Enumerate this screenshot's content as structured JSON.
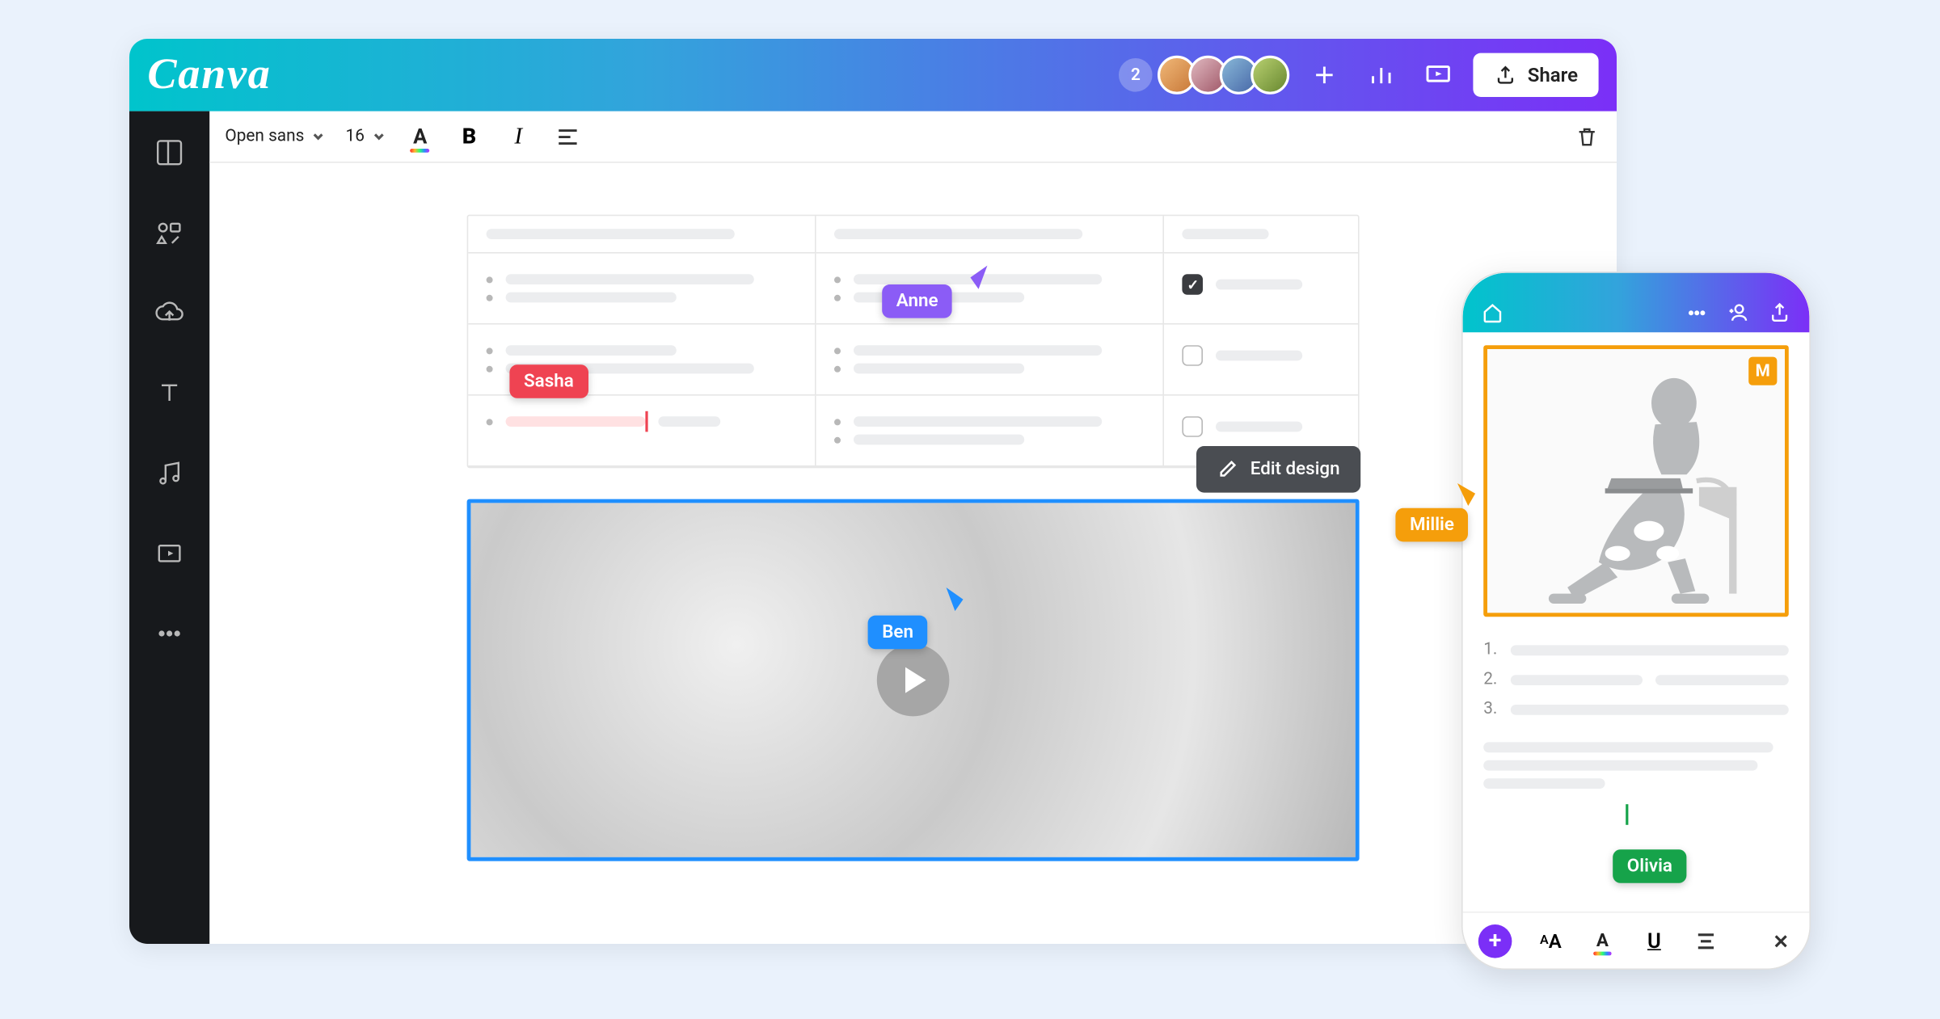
{
  "logo": "Canva",
  "topbar": {
    "collaborator_count": "2",
    "share_label": "Share"
  },
  "toolbar": {
    "font_family": "Open sans",
    "font_size": "16"
  },
  "cursors": {
    "anne": "Anne",
    "sasha": "Sasha",
    "ben": "Ben",
    "millie": "Millie",
    "olivia": "Olivia"
  },
  "edit_design_label": "Edit design",
  "phone": {
    "m_badge": "M",
    "list_numbers": [
      "1.",
      "2.",
      "3."
    ]
  }
}
